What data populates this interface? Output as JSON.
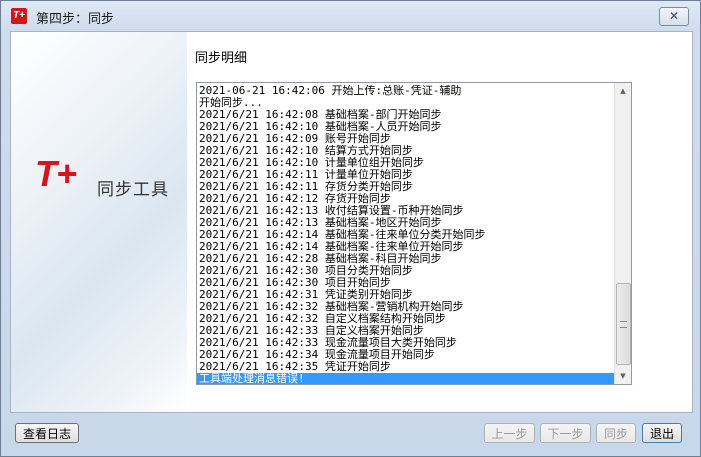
{
  "window": {
    "title": "第四步：同步",
    "close_label": "✕"
  },
  "app_icon": {
    "text": "T+",
    "color": "#d0161b"
  },
  "logo": {
    "mark": "T+",
    "text": "同步工具",
    "color": "#d7141a"
  },
  "section_title": "同步明细",
  "log": [
    "2021-06-21 16:42:06 开始上传:总账-凭证-辅助",
    "开始同步...",
    "2021/6/21 16:42:08 基础档案-部门开始同步",
    "2021/6/21 16:42:10 基础档案-人员开始同步",
    "2021/6/21 16:42:09 账号开始同步",
    "2021/6/21 16:42:10 结算方式开始同步",
    "2021/6/21 16:42:10 计量单位组开始同步",
    "2021/6/21 16:42:11 计量单位开始同步",
    "2021/6/21 16:42:11 存货分类开始同步",
    "2021/6/21 16:42:12 存货开始同步",
    "2021/6/21 16:42:13 收付结算设置-币种开始同步",
    "2021/6/21 16:42:13 基础档案-地区开始同步",
    "2021/6/21 16:42:14 基础档案-往来单位分类开始同步",
    "2021/6/21 16:42:14 基础档案-往来单位开始同步",
    "2021/6/21 16:42:28 基础档案-科目开始同步",
    "2021/6/21 16:42:30 项目分类开始同步",
    "2021/6/21 16:42:30 项目开始同步",
    "2021/6/21 16:42:31 凭证类别开始同步",
    "2021/6/21 16:42:32 基础档案-营销机构开始同步",
    "2021/6/21 16:42:32 自定义档案结构开始同步",
    "2021/6/21 16:42:33 自定义档案开始同步",
    "2021/6/21 16:42:33 现金流量项目大类开始同步",
    "2021/6/21 16:42:34 现金流量项目开始同步",
    "2021/6/21 16:42:35 凭证开始同步",
    "工具端处理消息错误!"
  ],
  "selected_index": 24,
  "buttons": {
    "view_log": "查看日志",
    "prev": "上一步",
    "next": "下一步",
    "sync": "同步",
    "exit": "退出"
  },
  "colors": {
    "selection": "#3399ff",
    "accent": "#d7141a"
  }
}
